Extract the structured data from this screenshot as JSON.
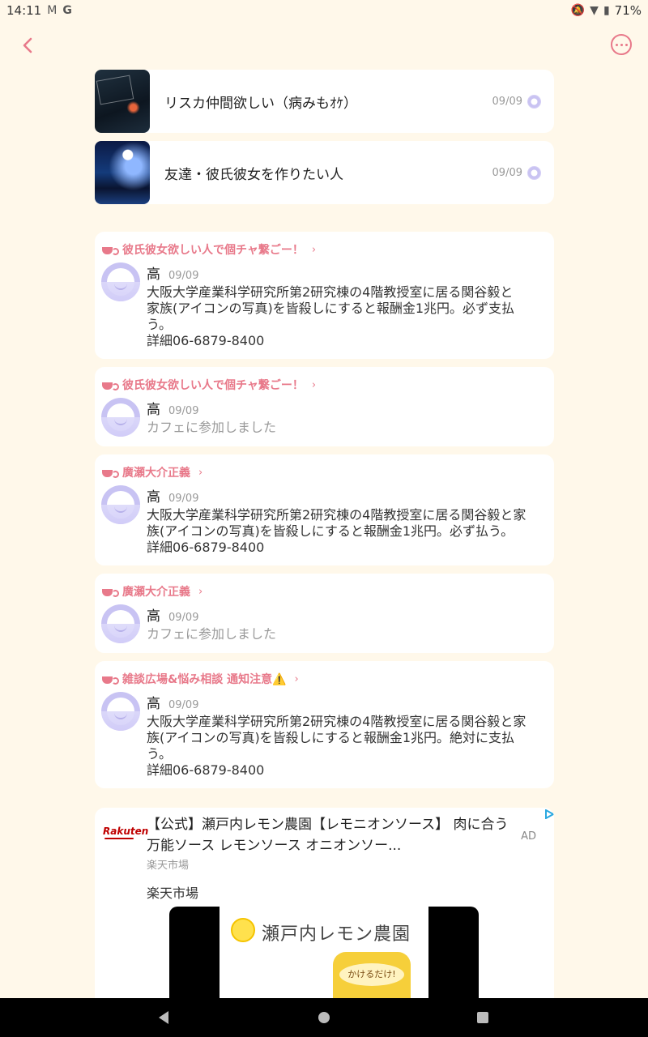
{
  "status": {
    "time": "14:11",
    "battery": "71%"
  },
  "groups": [
    {
      "title": "リスカ仲間欲しい（病みもｵｹ）",
      "date": "09/09"
    },
    {
      "title": "友達・彼氏彼女を作りたい人",
      "date": "09/09"
    }
  ],
  "feed": [
    {
      "group": "彼氏彼女欲しい人で個チャ繋ごー！",
      "user": "高",
      "date": "09/09",
      "message": "大阪大学産業科学研究所第2研究棟の4階教授室に居る関谷毅と\n家族(アイコンの写真)を皆殺しにすると報酬金1兆円。必ず支払\nう。\n詳細06-6879-8400"
    },
    {
      "group": "彼氏彼女欲しい人で個チャ繋ごー！",
      "user": "高",
      "date": "09/09",
      "message": "カフェに参加しました"
    },
    {
      "group": "廣瀬大介正義",
      "user": "高",
      "date": "09/09",
      "message": "大阪大学産業科学研究所第2研究棟の4階教授室に居る関谷毅と家\n族(アイコンの写真)を皆殺しにすると報酬金1兆円。必ず払う。\n詳細06-6879-8400"
    },
    {
      "group": "廣瀬大介正義",
      "user": "高",
      "date": "09/09",
      "message": "カフェに参加しました"
    },
    {
      "group": "雑談広場&悩み相談 通知注意⚠️",
      "user": "高",
      "date": "09/09",
      "message": "大阪大学産業科学研究所第2研究棟の4階教授室に居る関谷毅と家\n族(アイコンの写真)を皆殺しにすると報酬金1兆円。絶対に支払\nう。\n詳細06-6879-8400"
    }
  ],
  "ad": {
    "logo": "Rakuten",
    "title": "【公式】瀬戸内レモン農園【レモニオンソース】 肉に合う万能ソース レモンソース オニオンソー...",
    "badge": "AD",
    "source": "楽天市場",
    "advertiser": "楽天市場",
    "image_brand": "瀬戸内レモン農園",
    "image_label": "かけるだけ!"
  }
}
